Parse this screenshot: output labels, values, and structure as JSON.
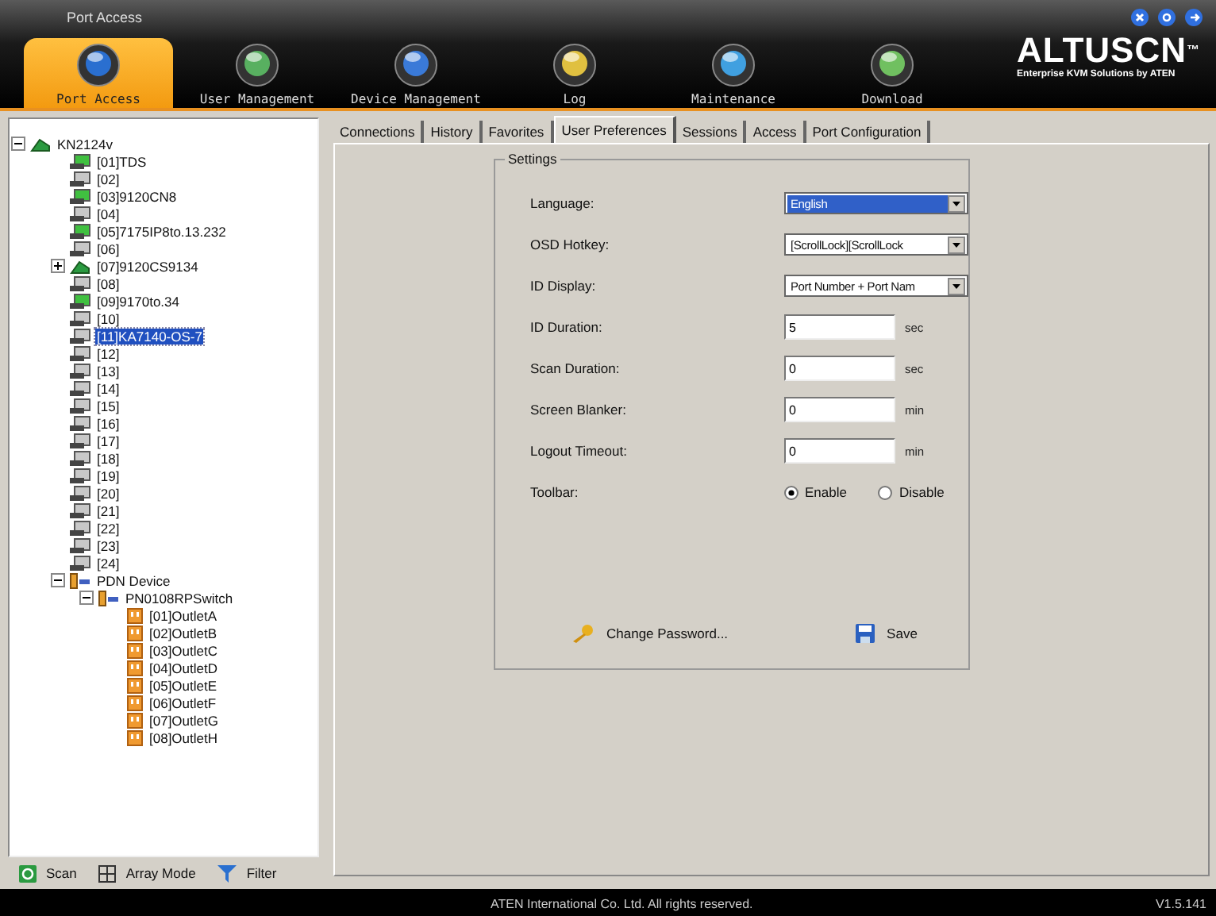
{
  "window": {
    "title": "Port Access"
  },
  "nav": [
    {
      "label": "Port Access",
      "selected": true
    },
    {
      "label": "User Management",
      "selected": false
    },
    {
      "label": "Device Management",
      "selected": false
    },
    {
      "label": "Log",
      "selected": false
    },
    {
      "label": "Maintenance",
      "selected": false
    },
    {
      "label": "Download",
      "selected": false
    }
  ],
  "logo": {
    "text": "ALTUSCN",
    "mark": "™",
    "tagline": "Enterprise KVM Solutions by ATEN"
  },
  "tree": {
    "items": [
      {
        "label": "KN2124v",
        "kind": "switch",
        "expanded": true,
        "selected": false,
        "children": [
          {
            "label": "[01]TDS",
            "kind": "port",
            "online": true,
            "selected": false
          },
          {
            "label": "[02]",
            "kind": "port",
            "online": false,
            "selected": false
          },
          {
            "label": "[03]9120CN8",
            "kind": "port",
            "online": true,
            "selected": false
          },
          {
            "label": "[04]",
            "kind": "port",
            "online": false,
            "selected": false
          },
          {
            "label": "[05]7175IP8to.13.232",
            "kind": "port",
            "online": true,
            "selected": false
          },
          {
            "label": "[06]",
            "kind": "port",
            "online": false,
            "selected": false
          },
          {
            "label": "[07]9120CS9134",
            "kind": "switch",
            "expanded": false,
            "selected": false
          },
          {
            "label": "[08]",
            "kind": "port",
            "online": false,
            "selected": false
          },
          {
            "label": "[09]9170to.34",
            "kind": "port",
            "online": true,
            "selected": false
          },
          {
            "label": "[10]",
            "kind": "port",
            "online": false,
            "selected": false
          },
          {
            "label": "[11]KA7140-OS-7",
            "kind": "port",
            "online": false,
            "selected": true
          },
          {
            "label": "[12]",
            "kind": "port",
            "online": false,
            "selected": false
          },
          {
            "label": "[13]",
            "kind": "port",
            "online": false,
            "selected": false
          },
          {
            "label": "[14]",
            "kind": "port",
            "online": false,
            "selected": false
          },
          {
            "label": "[15]",
            "kind": "port",
            "online": false,
            "selected": false
          },
          {
            "label": "[16]",
            "kind": "port",
            "online": false,
            "selected": false
          },
          {
            "label": "[17]",
            "kind": "port",
            "online": false,
            "selected": false
          },
          {
            "label": "[18]",
            "kind": "port",
            "online": false,
            "selected": false
          },
          {
            "label": "[19]",
            "kind": "port",
            "online": false,
            "selected": false
          },
          {
            "label": "[20]",
            "kind": "port",
            "online": false,
            "selected": false
          },
          {
            "label": "[21]",
            "kind": "port",
            "online": false,
            "selected": false
          },
          {
            "label": "[22]",
            "kind": "port",
            "online": false,
            "selected": false
          },
          {
            "label": "[23]",
            "kind": "port",
            "online": false,
            "selected": false
          },
          {
            "label": "[24]",
            "kind": "port",
            "online": false,
            "selected": false
          },
          {
            "label": "PDN Device",
            "kind": "pdu",
            "expanded": true,
            "selected": false,
            "children": [
              {
                "label": "PN0108RPSwitch",
                "kind": "pdu",
                "expanded": true,
                "selected": false,
                "children": [
                  {
                    "label": "[01]OutletA",
                    "kind": "outlet",
                    "selected": false
                  },
                  {
                    "label": "[02]OutletB",
                    "kind": "outlet",
                    "selected": false
                  },
                  {
                    "label": "[03]OutletC",
                    "kind": "outlet",
                    "selected": false
                  },
                  {
                    "label": "[04]OutletD",
                    "kind": "outlet",
                    "selected": false
                  },
                  {
                    "label": "[05]OutletE",
                    "kind": "outlet",
                    "selected": false
                  },
                  {
                    "label": "[06]OutletF",
                    "kind": "outlet",
                    "selected": false
                  },
                  {
                    "label": "[07]OutletG",
                    "kind": "outlet",
                    "selected": false
                  },
                  {
                    "label": "[08]OutletH",
                    "kind": "outlet",
                    "selected": false
                  }
                ]
              }
            ]
          }
        ]
      }
    ]
  },
  "tree_toolbar": [
    {
      "label": "Scan"
    },
    {
      "label": "Array Mode"
    },
    {
      "label": "Filter"
    }
  ],
  "tabs": [
    {
      "label": "Connections",
      "selected": false
    },
    {
      "label": "History",
      "selected": false
    },
    {
      "label": "Favorites",
      "selected": false
    },
    {
      "label": "User Preferences",
      "selected": true
    },
    {
      "label": "Sessions",
      "selected": false
    },
    {
      "label": "Access",
      "selected": false
    },
    {
      "label": "Port Configuration",
      "selected": false
    }
  ],
  "settings": {
    "legend": "Settings",
    "rows": [
      {
        "kind": "select",
        "label": "Language:",
        "value": "English",
        "focused": true
      },
      {
        "kind": "select",
        "label": "OSD Hotkey:",
        "value": "[ScrollLock][ScrollLock",
        "focused": false
      },
      {
        "kind": "select",
        "label": "ID Display:",
        "value": "Port Number + Port Nam",
        "focused": false
      },
      {
        "kind": "text",
        "label": "ID Duration:",
        "value": "5",
        "unit": "sec"
      },
      {
        "kind": "text",
        "label": "Scan Duration:",
        "value": "0",
        "unit": "sec"
      },
      {
        "kind": "text",
        "label": "Screen Blanker:",
        "value": "0",
        "unit": "min"
      },
      {
        "kind": "text",
        "label": "Logout Timeout:",
        "value": "0",
        "unit": "min"
      },
      {
        "kind": "radio",
        "label": "Toolbar:",
        "options": [
          {
            "label": "Enable",
            "selected": true
          },
          {
            "label": "Disable",
            "selected": false
          }
        ]
      }
    ],
    "buttons": [
      {
        "label": "Change Password..."
      },
      {
        "label": "Save"
      }
    ]
  },
  "status_bar": {
    "copyright": "ATEN International Co. Ltd. All rights reserved.",
    "version": "V1.5.141"
  }
}
